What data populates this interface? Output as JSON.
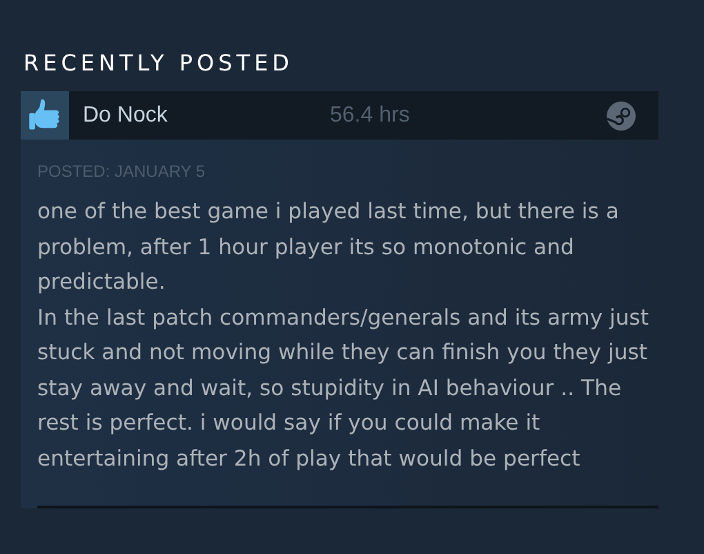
{
  "section_title": "RECENTLY POSTED",
  "review": {
    "recommended": true,
    "author": "Do Nock",
    "hours": "56.4 hrs",
    "posted": "POSTED: JANUARY 5",
    "text": "one of the best game i played last time, but there is a problem, after 1 hour player its so monotonic and predictable.\nIn the last patch commanders/generals and its army just stuck and not moving while they can finish you they just stay away and wait, so stupidity in AI behaviour .. The rest is perfect. i would say if you could make it entertaining after 2h of play that would be perfect"
  }
}
